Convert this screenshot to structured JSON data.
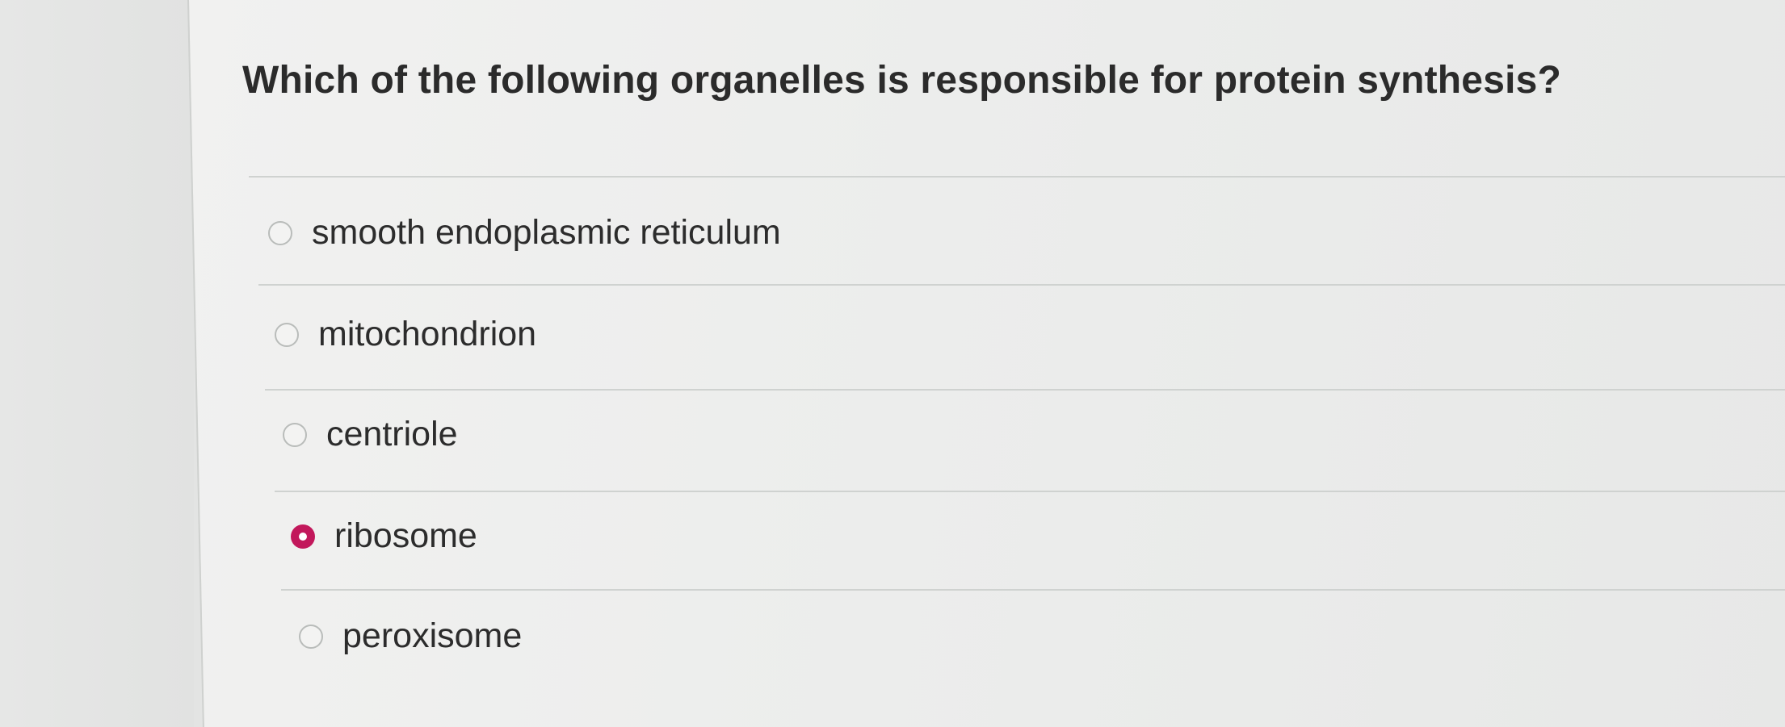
{
  "question": {
    "text": "Which of the following organelles is responsible for protein synthesis?"
  },
  "options": [
    {
      "label": "smooth endoplasmic reticulum",
      "selected": false
    },
    {
      "label": "mitochondrion",
      "selected": false
    },
    {
      "label": "centriole",
      "selected": false
    },
    {
      "label": "ribosome",
      "selected": true
    },
    {
      "label": "peroxisome",
      "selected": false
    }
  ],
  "colors": {
    "selected_radio": "#c2185b",
    "text": "#2c2c2c"
  }
}
